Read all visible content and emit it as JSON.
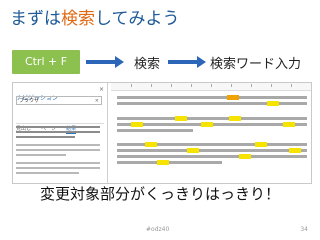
{
  "title": {
    "before": "まずは",
    "highlight": "検索",
    "after": "してみよう"
  },
  "flow": {
    "shortcut": "Ctrl + F",
    "step_search": "検索",
    "step_keyword": "検索ワード入力"
  },
  "nav_pane": {
    "title": "ナビゲーション",
    "close_glyph": "×",
    "search_value": "ブラウザ",
    "clear_glyph": "×",
    "tabs": [
      "見出し",
      "ページ",
      "結果"
    ],
    "active_tab_index": 2
  },
  "caption": "変更対象部分がくっきりはっきり！",
  "footer": {
    "tag": "#odz40",
    "page": "34"
  },
  "colors": {
    "title_blue": "#1f5a98",
    "title_highlight": "#e06a14",
    "shortcut_green": "#8cc04f",
    "arrow_blue": "#2b66b8",
    "match_yellow": "#f7e300",
    "match_current": "#f0a300"
  }
}
